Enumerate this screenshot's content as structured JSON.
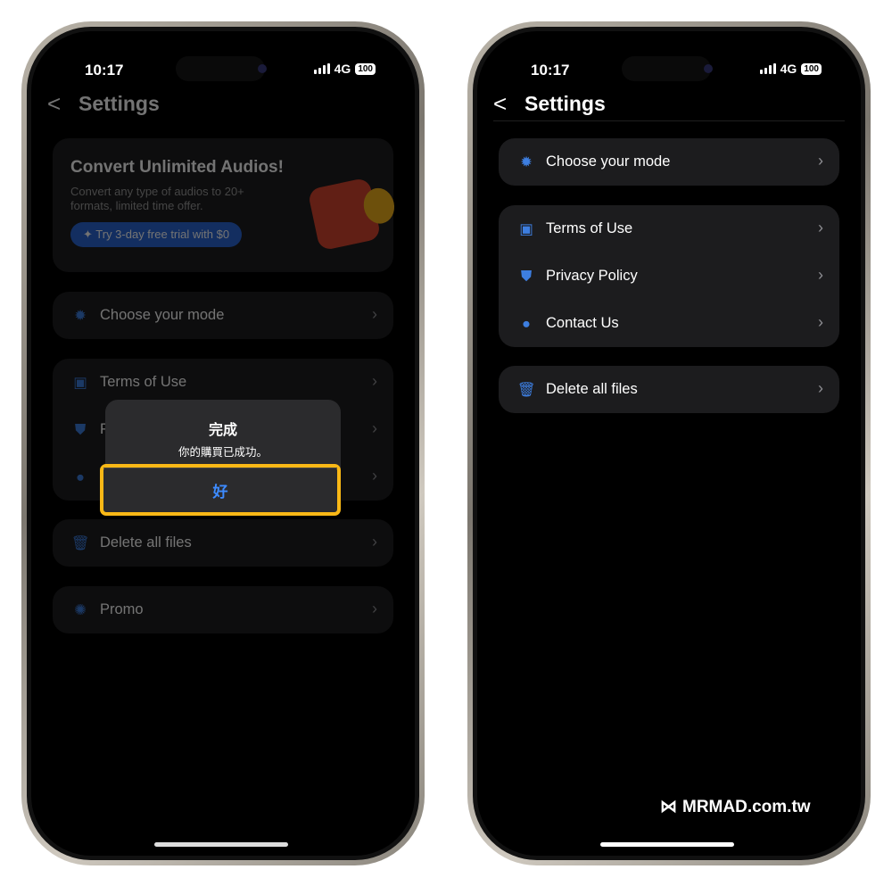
{
  "status": {
    "time": "10:17",
    "network": "4G",
    "battery": "100"
  },
  "header": {
    "back": "<",
    "title": "Settings"
  },
  "promo_card": {
    "title": "Convert Unlimited Audios!",
    "description": "Convert any type of audios to 20+ formats, limited time offer.",
    "button": "Try 3-day free trial with $0"
  },
  "rows": {
    "mode": "Choose your mode",
    "terms": "Terms of Use",
    "privacy": "Privacy Policy",
    "contact": "Contact Us",
    "delete": "Delete all files",
    "promo": "Promo"
  },
  "dialog": {
    "title": "完成",
    "message": "你的購買已成功。",
    "ok": "好"
  },
  "watermark": "MRMAD.com.tw",
  "colors": {
    "accent": "#3d7ee0",
    "highlight": "#f9b816"
  }
}
